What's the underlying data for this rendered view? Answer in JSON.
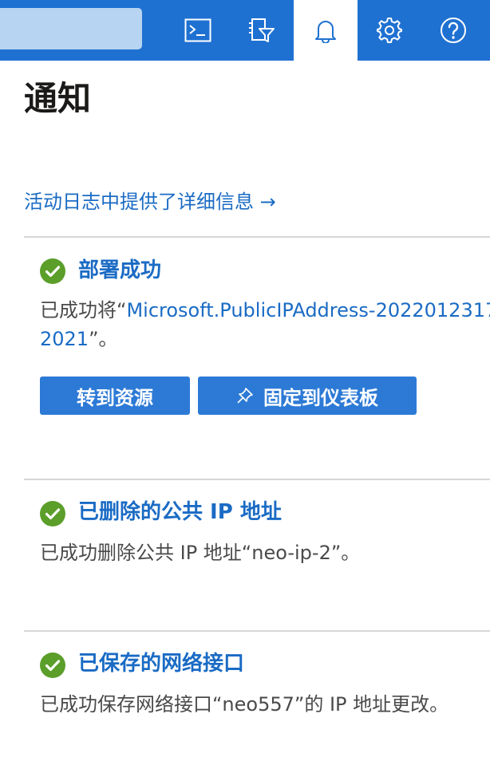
{
  "topbar": {
    "icons": [
      "cloud-shell-icon",
      "directory-filter-icon",
      "bell-icon",
      "gear-icon",
      "help-icon"
    ],
    "accent": "#1f71d1",
    "active_icon": "bell-icon"
  },
  "panel": {
    "title": "通知",
    "activity_link": "活动日志中提供了详细信息 →"
  },
  "notifications": [
    {
      "title": "部署成功",
      "status_icon": "check-circle-icon",
      "body_prefix": "已成功将“",
      "body_link_line1": "Microsoft.PublicIPAddress-2022012317",
      "body_link_line2": "2021",
      "body_suffix": "”。",
      "buttons": [
        {
          "label": "转到资源"
        },
        {
          "label": "固定到仪表板",
          "icon": "pin-icon"
        }
      ]
    },
    {
      "title": "已删除的公共 IP 地址",
      "status_icon": "check-circle-icon",
      "body": "已成功删除公共 IP 地址“neo-ip-2”。"
    },
    {
      "title": "已保存的网络接口",
      "status_icon": "check-circle-icon",
      "body": "已成功保存网络接口“neo557”的 IP 地址更改。"
    }
  ],
  "colors": {
    "success": "#5b9e2a",
    "link": "#1a6bc4",
    "button": "#2d7ad6"
  }
}
